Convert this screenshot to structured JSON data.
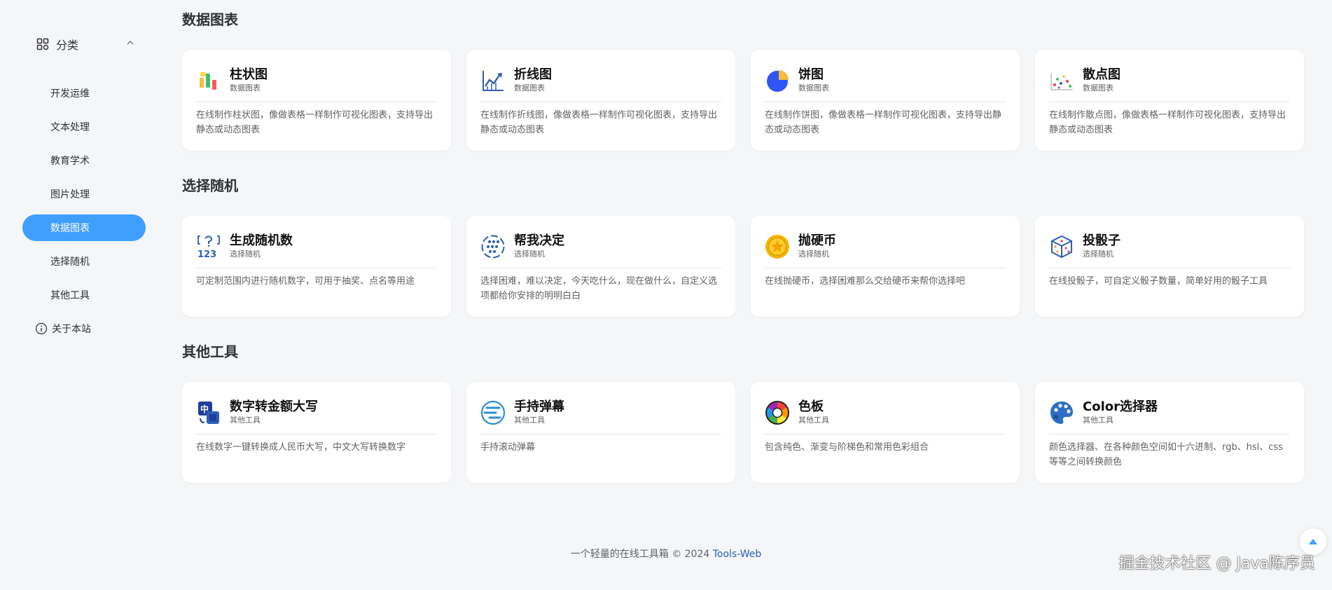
{
  "sidebar": {
    "category_label": "分类",
    "items": [
      {
        "label": "开发运维"
      },
      {
        "label": "文本处理"
      },
      {
        "label": "教育学术"
      },
      {
        "label": "图片处理"
      },
      {
        "label": "数据图表"
      },
      {
        "label": "选择随机"
      },
      {
        "label": "其他工具"
      },
      {
        "label": "关于本站"
      }
    ],
    "active_index": 4
  },
  "sections": [
    {
      "title": "数据图表",
      "cards": [
        {
          "name": "柱状图",
          "tag": "数据图表",
          "desc": "在线制作柱状图，像做表格一样制作可视化图表，支持导出静态或动态图表",
          "icon": "bar-chart-icon"
        },
        {
          "name": "折线图",
          "tag": "数据图表",
          "desc": "在线制作折线图，像做表格一样制作可视化图表，支持导出静态或动态图表",
          "icon": "line-chart-icon"
        },
        {
          "name": "饼图",
          "tag": "数据图表",
          "desc": "在线制作饼图，像做表格一样制作可视化图表，支持导出静态或动态图表",
          "icon": "pie-chart-icon"
        },
        {
          "name": "散点图",
          "tag": "数据图表",
          "desc": "在线制作散点图，像做表格一样制作可视化图表，支持导出静态或动态图表",
          "icon": "scatter-chart-icon"
        }
      ]
    },
    {
      "title": "选择随机",
      "cards": [
        {
          "name": "生成随机数",
          "tag": "选择随机",
          "desc": "可定制范围内进行随机数字，可用于抽奖、点名等用途",
          "icon": "random-number-icon"
        },
        {
          "name": "帮我决定",
          "tag": "选择随机",
          "desc": "选择困难，难以决定，今天吃什么，现在做什么，自定义选项都给你安排的明明白白",
          "icon": "decision-wheel-icon"
        },
        {
          "name": "抛硬币",
          "tag": "选择随机",
          "desc": "在线抛硬币，选择困难那么交给硬币来帮你选择吧",
          "icon": "coin-icon"
        },
        {
          "name": "投骰子",
          "tag": "选择随机",
          "desc": "在线投骰子，可自定义骰子数量，简单好用的骰子工具",
          "icon": "dice-icon"
        }
      ]
    },
    {
      "title": "其他工具",
      "cards": [
        {
          "name": "数字转金额大写",
          "tag": "其他工具",
          "desc": "在线数字一键转换成人民币大写，中文大写转换数字",
          "icon": "chinese-number-icon"
        },
        {
          "name": "手持弹幕",
          "tag": "其他工具",
          "desc": "手持滚动弹幕",
          "icon": "danmaku-icon"
        },
        {
          "name": "色板",
          "tag": "其他工具",
          "desc": "包含纯色、渐变与阶梯色和常用色彩组合",
          "icon": "color-wheel-icon"
        },
        {
          "name": "Color选择器",
          "tag": "其他工具",
          "desc": "颜色选择器、在各种颜色空间如十六进制、rgb、hsl、css等等之间转换颜色",
          "icon": "palette-icon"
        }
      ]
    }
  ],
  "footer": {
    "text": "一个轻量的在线工具箱 © 2024 ",
    "brand": "Tools-Web"
  },
  "watermark": "掘金技术社区 @ Java陈序员",
  "colors": {
    "accent": "#409eff",
    "background": "#f5f6f7"
  }
}
